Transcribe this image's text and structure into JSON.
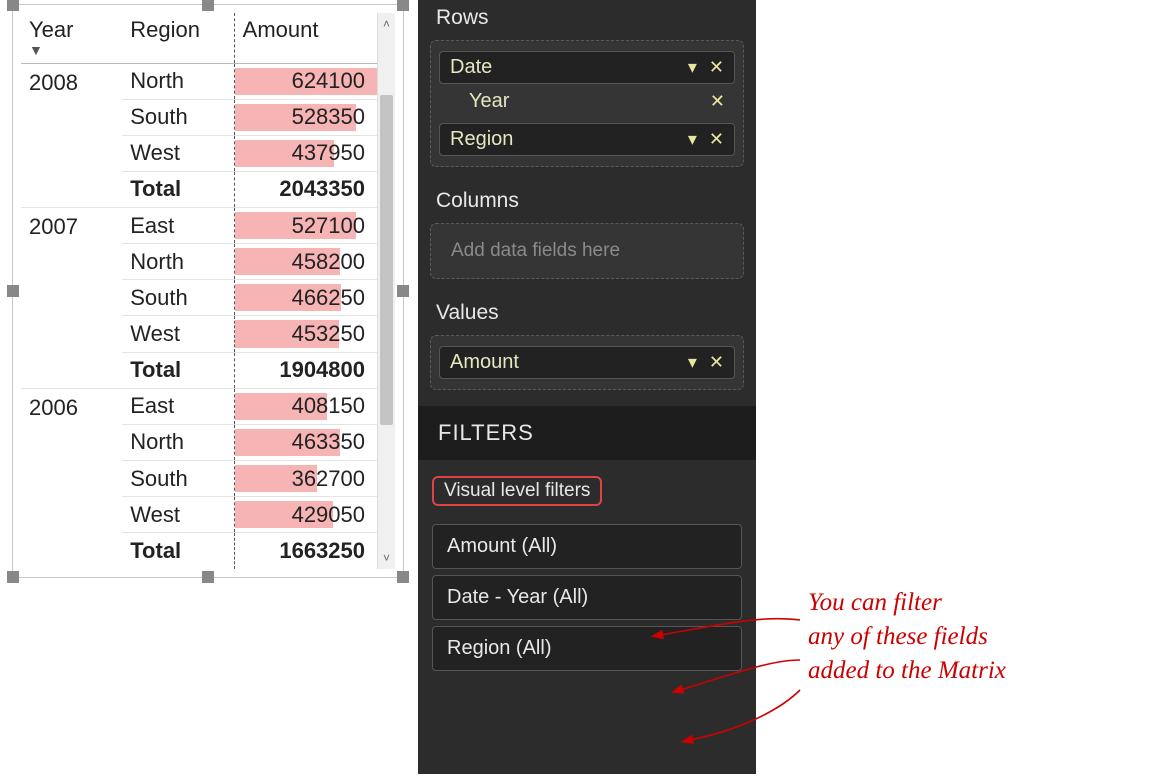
{
  "matrix": {
    "headers": {
      "year": "Year",
      "region": "Region",
      "amount": "Amount"
    },
    "sort_indicator": "▼",
    "groups": [
      {
        "year": "2008",
        "rows": [
          {
            "region": "North",
            "amount": "624100",
            "barPct": 100
          },
          {
            "region": "South",
            "amount": "528350",
            "barPct": 85
          },
          {
            "region": "West",
            "amount": "437950",
            "barPct": 70
          }
        ],
        "total_label": "Total",
        "total": "2043350"
      },
      {
        "year": "2007",
        "rows": [
          {
            "region": "East",
            "amount": "527100",
            "barPct": 85
          },
          {
            "region": "North",
            "amount": "458200",
            "barPct": 74
          },
          {
            "region": "South",
            "amount": "466250",
            "barPct": 75
          },
          {
            "region": "West",
            "amount": "453250",
            "barPct": 73
          }
        ],
        "total_label": "Total",
        "total": "1904800"
      },
      {
        "year": "2006",
        "rows": [
          {
            "region": "East",
            "amount": "408150",
            "barPct": 65
          },
          {
            "region": "North",
            "amount": "463350",
            "barPct": 74
          },
          {
            "region": "South",
            "amount": "362700",
            "barPct": 58
          },
          {
            "region": "West",
            "amount": "429050",
            "barPct": 69
          }
        ],
        "total_label": "Total",
        "total": "1663250"
      }
    ]
  },
  "panel": {
    "rows_label": "Rows",
    "rows_fields": {
      "date": "Date",
      "year": "Year",
      "region": "Region"
    },
    "columns_label": "Columns",
    "columns_placeholder": "Add data fields here",
    "values_label": "Values",
    "values_field": "Amount",
    "filters_header": "FILTERS",
    "vlf_label": "Visual level filters",
    "filters": {
      "amount": "Amount  (All)",
      "date_year": "Date - Year  (All)",
      "region": "Region  (All)"
    }
  },
  "annotation": {
    "line1": "You can filter",
    "line2": "any of these fields",
    "line3": "added to the Matrix"
  }
}
